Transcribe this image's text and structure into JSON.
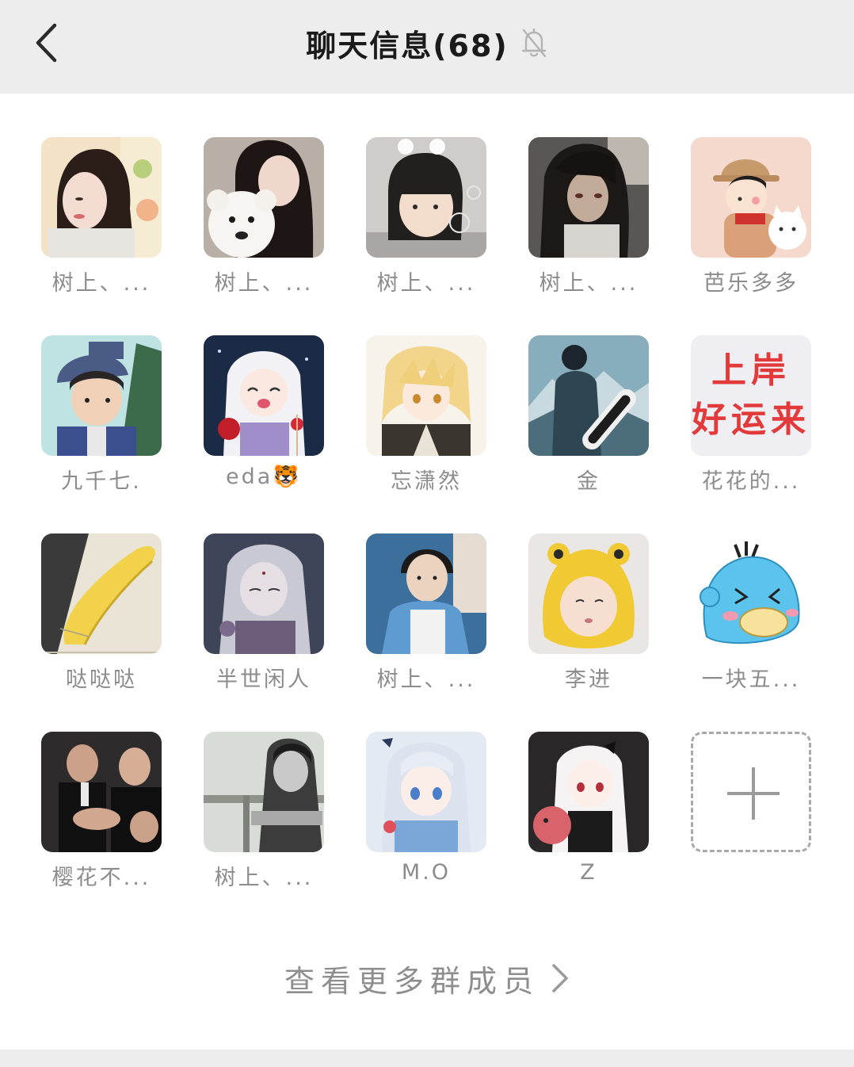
{
  "header": {
    "title": "聊天信息(68)",
    "back_icon": "chevron-left-icon",
    "mute_icon": "bell-off-icon"
  },
  "members": [
    {
      "name": "树上、...",
      "avatar": "photo-girl-long-hair"
    },
    {
      "name": "树上、...",
      "avatar": "photo-girl-with-teddy-bear"
    },
    {
      "name": "树上、...",
      "avatar": "photo-little-girl-bubbles"
    },
    {
      "name": "树上、...",
      "avatar": "anime-dark-hair-girl"
    },
    {
      "name": "芭乐多多",
      "avatar": "cartoon-boy-with-cat"
    },
    {
      "name": "九千七.",
      "avatar": "anime-boy-cap-hsp"
    },
    {
      "name": "eda🐯",
      "avatar": "anime-white-hair-girl-candy-apple"
    },
    {
      "name": "忘潇然",
      "avatar": "anime-blonde-boy"
    },
    {
      "name": "金",
      "avatar": "photo-snowboarder"
    },
    {
      "name": "花花的...",
      "avatar": "text-image-red-characters",
      "avatar_text": "上岸\n好运来"
    },
    {
      "name": "哒哒哒",
      "avatar": "photo-banana"
    },
    {
      "name": "半世闲人",
      "avatar": "art-silver-hair-figure"
    },
    {
      "name": "树上、...",
      "avatar": "photo-young-man"
    },
    {
      "name": "李进",
      "avatar": "photo-baby-frog-hat"
    },
    {
      "name": "一块五...",
      "avatar": "cartoon-blue-duck"
    },
    {
      "name": "樱花不...",
      "avatar": "photo-men-in-suits"
    },
    {
      "name": "树上、...",
      "avatar": "photo-bw-man"
    },
    {
      "name": "M.O",
      "avatar": "anime-silver-hair-girl-blue-eyes"
    },
    {
      "name": "Z",
      "avatar": "anime-white-hair-girl-dark-bg"
    }
  ],
  "add_member": {
    "icon": "plus-icon"
  },
  "view_more": {
    "label": "查看更多群成员",
    "icon": "chevron-right-icon"
  },
  "colors": {
    "header_bg": "#ededed",
    "name_gray": "#8c8c8c",
    "title": "#1b1b1b"
  }
}
